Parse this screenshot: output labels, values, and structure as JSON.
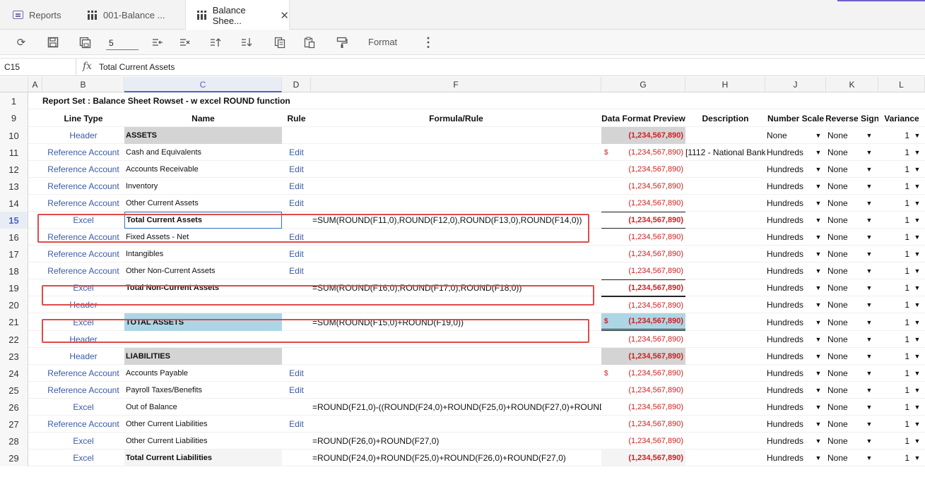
{
  "tabs": [
    {
      "label": "Reports"
    },
    {
      "label": "001-Balance ..."
    },
    {
      "label": "Balance Shee..."
    }
  ],
  "toolbar": {
    "page_value": "5",
    "format_label": "Format"
  },
  "formula_bar": {
    "cell_ref": "C15",
    "fx_label": "fx",
    "value": "Total Current Assets"
  },
  "columns": [
    "A",
    "B",
    "C",
    "D",
    "F",
    "G",
    "H",
    "J",
    "K",
    "L"
  ],
  "report_title": "Report Set : Balance Sheet Rowset - w excel ROUND function",
  "headers": {
    "line_type": "Line Type",
    "name": "Name",
    "rule": "Rule",
    "formula": "Formula/Rule",
    "preview": "Data Format Preview",
    "description": "Description",
    "scale": "Number Scale",
    "reverse": "Reverse Sign",
    "variance": "Variance"
  },
  "row_numbers": [
    "1",
    "9",
    "10",
    "11",
    "12",
    "13",
    "14",
    "15",
    "16",
    "17",
    "18",
    "19",
    "20",
    "21",
    "22",
    "23",
    "24",
    "25",
    "26",
    "27",
    "28",
    "29"
  ],
  "rows": [
    {
      "num": "10",
      "type": "Header",
      "name": "ASSETS",
      "rule": "",
      "formula": "",
      "preview": "(1,234,567,890)",
      "dollar": "",
      "desc": "",
      "scale": "None",
      "reverse": "None",
      "variance": "1"
    },
    {
      "num": "11",
      "type": "Reference Account",
      "name": "Cash and Equivalents",
      "rule": "Edit",
      "formula": "",
      "preview": "(1,234,567,890)",
      "dollar": "$",
      "desc": "[1112 - National Bank",
      "scale": "Hundreds",
      "reverse": "None",
      "variance": "1"
    },
    {
      "num": "12",
      "type": "Reference Account",
      "name": "Accounts Receivable",
      "rule": "Edit",
      "formula": "",
      "preview": "(1,234,567,890)",
      "dollar": "",
      "desc": "",
      "scale": "Hundreds",
      "reverse": "None",
      "variance": "1"
    },
    {
      "num": "13",
      "type": "Reference Account",
      "name": "Inventory",
      "rule": "Edit",
      "formula": "",
      "preview": "(1,234,567,890)",
      "dollar": "",
      "desc": "",
      "scale": "Hundreds",
      "reverse": "None",
      "variance": "1"
    },
    {
      "num": "14",
      "type": "Reference Account",
      "name": "Other Current Assets",
      "rule": "Edit",
      "formula": "",
      "preview": "(1,234,567,890)",
      "dollar": "",
      "desc": "",
      "scale": "Hundreds",
      "reverse": "None",
      "variance": "1"
    },
    {
      "num": "15",
      "type": "Excel",
      "name": "Total Current Assets",
      "rule": "",
      "formula": "=SUM(ROUND(F11,0),ROUND(F12,0),ROUND(F13,0),ROUND(F14,0))",
      "preview": "(1,234,567,890)",
      "dollar": "",
      "desc": "",
      "scale": "Hundreds",
      "reverse": "None",
      "variance": "1"
    },
    {
      "num": "16",
      "type": "Reference Account",
      "name": "Fixed Assets - Net",
      "rule": "Edit",
      "formula": "",
      "preview": "(1,234,567,890)",
      "dollar": "",
      "desc": "",
      "scale": "Hundreds",
      "reverse": "None",
      "variance": "1"
    },
    {
      "num": "17",
      "type": "Reference Account",
      "name": "Intangibles",
      "rule": "Edit",
      "formula": "",
      "preview": "(1,234,567,890)",
      "dollar": "",
      "desc": "",
      "scale": "Hundreds",
      "reverse": "None",
      "variance": "1"
    },
    {
      "num": "18",
      "type": "Reference Account",
      "name": "Other Non-Current Assets",
      "rule": "Edit",
      "formula": "",
      "preview": "(1,234,567,890)",
      "dollar": "",
      "desc": "",
      "scale": "Hundreds",
      "reverse": "None",
      "variance": "1"
    },
    {
      "num": "19",
      "type": "Excel",
      "name": "Total Non-Current Assets",
      "rule": "",
      "formula": "=SUM(ROUND(F16,0),ROUND(F17,0),ROUND(F18,0))",
      "preview": "(1,234,567,890)",
      "dollar": "",
      "desc": "",
      "scale": "Hundreds",
      "reverse": "None",
      "variance": "1"
    },
    {
      "num": "20",
      "type": "Header",
      "name": "",
      "rule": "",
      "formula": "",
      "preview": "(1,234,567,890)",
      "dollar": "",
      "desc": "",
      "scale": "Hundreds",
      "reverse": "None",
      "variance": "1"
    },
    {
      "num": "21",
      "type": "Excel",
      "name": "TOTAL ASSETS",
      "rule": "",
      "formula": "=SUM(ROUND(F15,0)+ROUND(F19,0))",
      "preview": "(1,234,567,890)",
      "dollar": "$",
      "desc": "",
      "scale": "Hundreds",
      "reverse": "None",
      "variance": "1"
    },
    {
      "num": "22",
      "type": "Header",
      "name": "",
      "rule": "",
      "formula": "",
      "preview": "(1,234,567,890)",
      "dollar": "",
      "desc": "",
      "scale": "Hundreds",
      "reverse": "None",
      "variance": "1"
    },
    {
      "num": "23",
      "type": "Header",
      "name": "LIABILITIES",
      "rule": "",
      "formula": "",
      "preview": "(1,234,567,890)",
      "dollar": "",
      "desc": "",
      "scale": "Hundreds",
      "reverse": "None",
      "variance": "1"
    },
    {
      "num": "24",
      "type": "Reference Account",
      "name": "Accounts Payable",
      "rule": "Edit",
      "formula": "",
      "preview": "(1,234,567,890)",
      "dollar": "$",
      "desc": "",
      "scale": "Hundreds",
      "reverse": "None",
      "variance": "1"
    },
    {
      "num": "25",
      "type": "Reference Account",
      "name": "Payroll Taxes/Benefits",
      "rule": "Edit",
      "formula": "",
      "preview": "(1,234,567,890)",
      "dollar": "",
      "desc": "",
      "scale": "Hundreds",
      "reverse": "None",
      "variance": "1"
    },
    {
      "num": "26",
      "type": "Excel",
      "name": "Out of Balance",
      "rule": "",
      "formula": "=ROUND(F21,0)-((ROUND(F24,0)+ROUND(F25,0)+ROUND(F27,0)+ROUND",
      "preview": "(1,234,567,890)",
      "dollar": "",
      "desc": "",
      "scale": "Hundreds",
      "reverse": "None",
      "variance": "1"
    },
    {
      "num": "27",
      "type": "Reference Account",
      "name": "Other Current Liabilities",
      "rule": "Edit",
      "formula": "",
      "preview": "(1,234,567,890)",
      "dollar": "",
      "desc": "",
      "scale": "Hundreds",
      "reverse": "None",
      "variance": "1"
    },
    {
      "num": "28",
      "type": "Excel",
      "name": "Other Current Liabilities",
      "rule": "",
      "formula": "=ROUND(F26,0)+ROUND(F27,0)",
      "preview": "(1,234,567,890)",
      "dollar": "",
      "desc": "",
      "scale": "Hundreds",
      "reverse": "None",
      "variance": "1"
    },
    {
      "num": "29",
      "type": "Excel",
      "name": "Total Current Liabilities",
      "rule": "",
      "formula": "=ROUND(F24,0)+ROUND(F25,0)+ROUND(F26,0)+ROUND(F27,0)",
      "preview": "(1,234,567,890)",
      "dollar": "",
      "desc": "",
      "scale": "Hundreds",
      "reverse": "None",
      "variance": "1"
    }
  ],
  "colors": {
    "link_blue": "#3b5aa6",
    "preview_red": "#d02020",
    "highlight_box": "#e04a4a",
    "total_fill": "#acd6e5",
    "header_fill": "#d4d4d4"
  }
}
